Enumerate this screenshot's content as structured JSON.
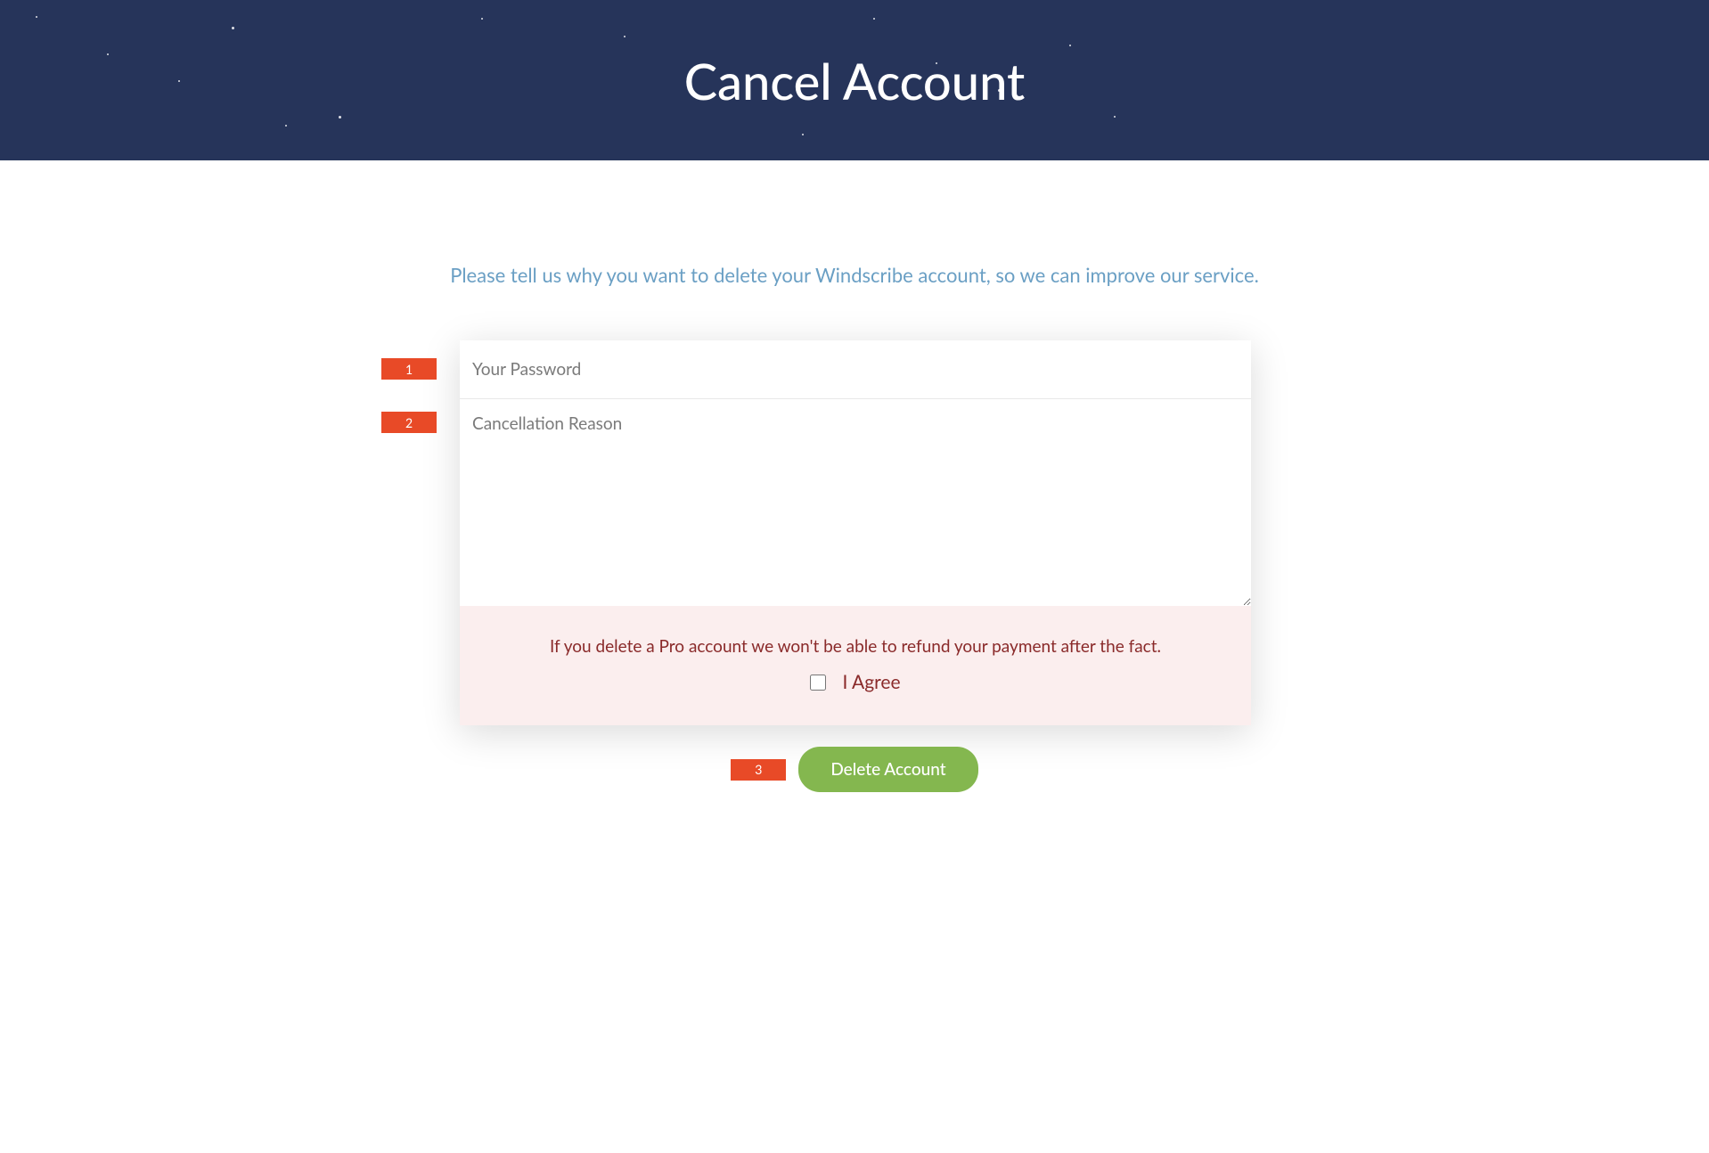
{
  "page": {
    "title": "Cancel Account",
    "subtitle": "Please tell us why you want to delete your Windscribe account, so we can improve our service."
  },
  "form": {
    "password": {
      "placeholder": "Your Password",
      "value": ""
    },
    "reason": {
      "placeholder": "Cancellation Reason",
      "value": ""
    },
    "warning": "If you delete a Pro account we won't be able to refund your payment after the fact.",
    "agree_label": "I Agree",
    "agree_checked": false,
    "submit_label": "Delete Account"
  },
  "badges": {
    "b1": "1",
    "b2": "2",
    "b3": "3"
  }
}
